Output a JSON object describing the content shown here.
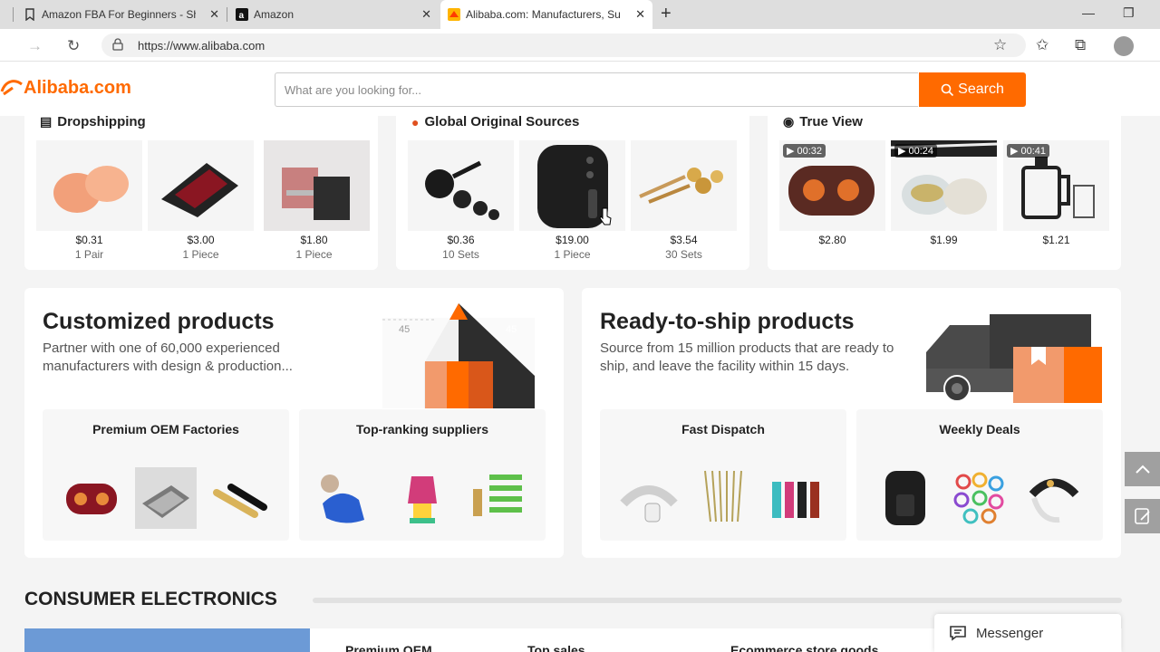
{
  "browser": {
    "tabs": [
      {
        "title": "Amazon FBA For Beginners - Sha",
        "icon": "bookmark-icon"
      },
      {
        "title": "Amazon",
        "icon": "amazon-icon"
      },
      {
        "title": "Alibaba.com: Manufacturers, Sup",
        "icon": "alibaba-icon"
      }
    ],
    "url": "https://www.alibaba.com"
  },
  "site": {
    "logo_text": "Alibaba.com",
    "search_placeholder": "What are you looking for...",
    "search_button": "Search",
    "brand_color": "#ff6a00"
  },
  "categories": [
    {
      "title": "Dropshipping",
      "items": [
        {
          "price": "$0.31",
          "unit": "1 Pair"
        },
        {
          "price": "$3.00",
          "unit": "1 Piece"
        },
        {
          "price": "$1.80",
          "unit": "1 Piece"
        }
      ]
    },
    {
      "title": "Global Original Sources",
      "items": [
        {
          "price": "$0.36",
          "unit": "10 Sets"
        },
        {
          "price": "$19.00",
          "unit": "1 Piece"
        },
        {
          "price": "$3.54",
          "unit": "30 Sets"
        }
      ]
    },
    {
      "title": "True View",
      "items": [
        {
          "price": "$2.80",
          "badge": "00:32"
        },
        {
          "price": "$1.99",
          "badge": "00:24"
        },
        {
          "price": "$1.21",
          "badge": "00:41"
        }
      ]
    }
  ],
  "customized": {
    "title": "Customized products",
    "subtitle": "Partner with one of 60,000 experienced manufacturers with design & production...",
    "illus_labels": [
      "45",
      "45"
    ],
    "cards": [
      {
        "label": "Premium OEM Factories"
      },
      {
        "label": "Top-ranking suppliers"
      }
    ]
  },
  "ready": {
    "title": "Ready-to-ship products",
    "subtitle": "Source from 15 million products that are ready to ship, and leave the facility within 15 days.",
    "cards": [
      {
        "label": "Fast Dispatch"
      },
      {
        "label": "Weekly Deals"
      }
    ]
  },
  "consumer": {
    "title": "CONSUMER ELECTRONICS",
    "tabs": [
      "Premium OEM",
      "Top sales",
      "Ecommerce store goods"
    ]
  },
  "messenger": {
    "label": "Messenger"
  }
}
